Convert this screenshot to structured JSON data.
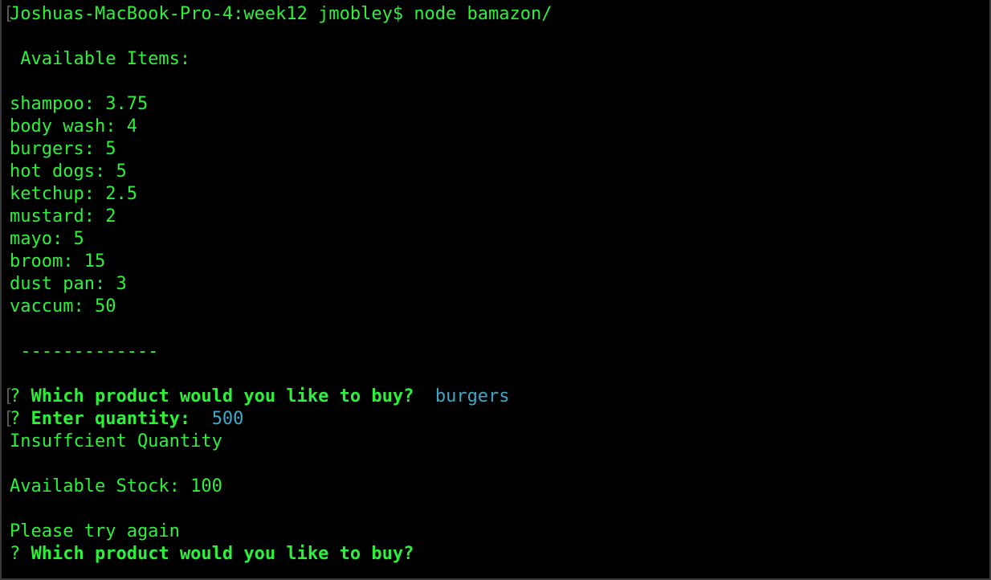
{
  "terminal": {
    "prompt_command": "Joshuas-MacBook-Pro-4:week12 jmobley$ node bamazon/",
    "header": " Available Items:",
    "items": [
      "shampoo: 3.75",
      "body wash: 4",
      "burgers: 5",
      "hot dogs: 5",
      "ketchup: 2.5",
      "mustard: 2",
      "mayo: 5",
      "broom: 15",
      "dust pan: 3",
      "vaccum: 50"
    ],
    "separator": " -------------",
    "question_mark": "?",
    "q1_text": "Which product would you like to buy?",
    "q1_answer": "burgers",
    "q2_text": "Enter quantity:",
    "q2_answer": "500",
    "msg_insufficient": "Insuffcient Quantity",
    "msg_stock": "Available Stock: 100",
    "msg_retry": "Please try again",
    "q3_text": "Which product would you like to buy?",
    "colors": {
      "background": "#000000",
      "text_green": "#2ef03a",
      "answer_cyan": "#3fa7c9"
    }
  }
}
